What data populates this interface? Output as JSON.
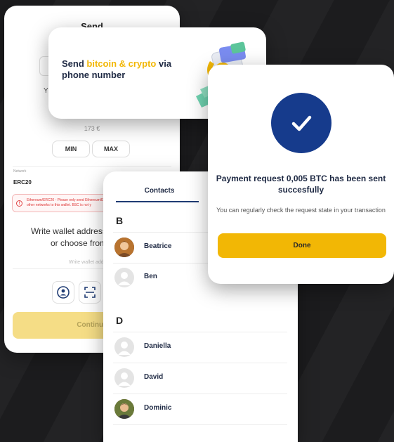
{
  "send_screen": {
    "title": "Send",
    "partial_letter": "Y",
    "amount_eur": "173 €",
    "min_label": "MIN",
    "max_label": "MAX",
    "network_label": "Network",
    "network_value": "ERC20",
    "warning_text": "Ethereum/ERC20 - Please only send Ethereum/ERC20 tokens to this address. Sending any other networks to this wallet. BSC is not y",
    "write_text_line1": "Write wallet address, t",
    "write_text_line2": "or choose from c",
    "address_placeholder": "Write wallet addre",
    "continue_label": "Continue"
  },
  "promo": {
    "text_before": "Send ",
    "text_highlight": "bitcoin & crypto",
    "text_after": " via",
    "text_line2": "phone number"
  },
  "contacts": {
    "tab_label": "Contacts",
    "sections": [
      {
        "letter": "B",
        "people": [
          {
            "name": "Beatrice",
            "has_photo": true
          },
          {
            "name": "Ben",
            "has_photo": false
          }
        ]
      },
      {
        "letter": "D",
        "people": [
          {
            "name": "Daniella",
            "has_photo": false
          },
          {
            "name": "David",
            "has_photo": false
          },
          {
            "name": "Dominic",
            "has_photo": true
          }
        ]
      }
    ]
  },
  "payment": {
    "title": "Payment request 0,005 BTC has been sent succesfully",
    "subtitle": "You can regularly check the request state in your transaction",
    "done_label": "Done"
  },
  "colors": {
    "accent_yellow": "#f2b705",
    "brand_blue": "#163b8c",
    "text_dark": "#1f2a44"
  },
  "icons": [
    "contact-book-icon",
    "scan-qr-icon",
    "checkmark-icon",
    "user-placeholder-icon",
    "warning-icon",
    "crypto-phone-illustration"
  ]
}
